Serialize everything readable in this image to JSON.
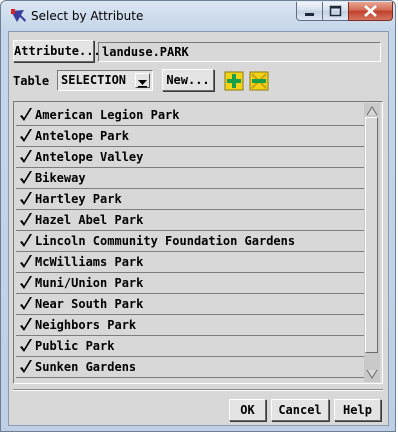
{
  "window": {
    "title": "Select by Attribute"
  },
  "attribute": {
    "button_label": "Attribute...",
    "value": "landuse.PARK"
  },
  "table": {
    "label": "Table",
    "selected": "SELECTION",
    "new_label": "New..."
  },
  "toolbar": {
    "add_icon": "add-all-icon",
    "remove_icon": "remove-all-icon"
  },
  "items": [
    {
      "label": "American Legion Park",
      "checked": true
    },
    {
      "label": "Antelope Park",
      "checked": true
    },
    {
      "label": "Antelope Valley",
      "checked": true
    },
    {
      "label": "Bikeway",
      "checked": true
    },
    {
      "label": "Hartley Park",
      "checked": true
    },
    {
      "label": "Hazel Abel Park",
      "checked": true
    },
    {
      "label": "Lincoln Community Foundation Gardens",
      "checked": true
    },
    {
      "label": "McWilliams Park",
      "checked": true
    },
    {
      "label": "Muni/Union Park",
      "checked": true
    },
    {
      "label": "Near South Park",
      "checked": true
    },
    {
      "label": "Neighbors Park",
      "checked": true
    },
    {
      "label": "Public Park",
      "checked": true
    },
    {
      "label": "Sunken Gardens",
      "checked": true
    }
  ],
  "footer": {
    "ok_label": "OK",
    "cancel_label": "Cancel",
    "help_label": "Help"
  },
  "colors": {
    "titlebar": "#c6d6ea",
    "panel": "#d8d8d8",
    "close": "#c0402a"
  }
}
